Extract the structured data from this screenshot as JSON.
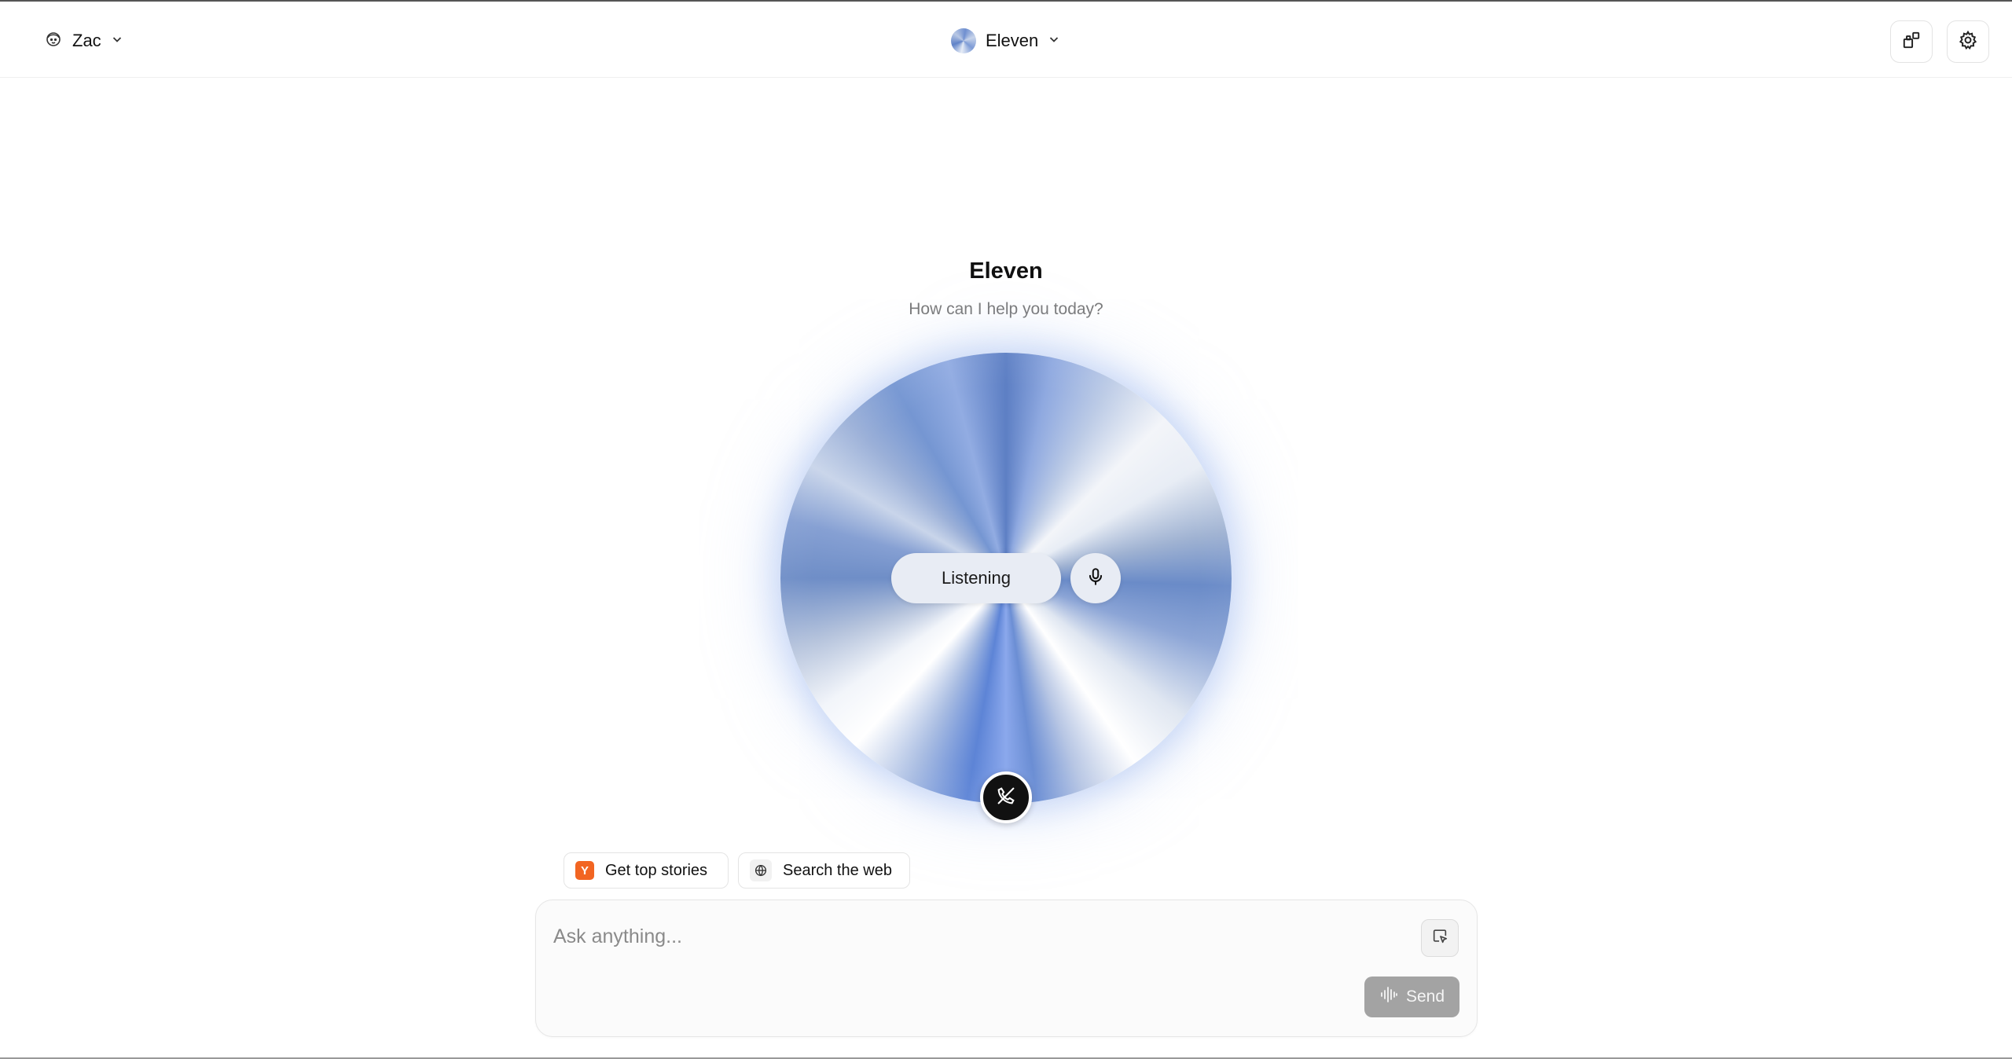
{
  "header": {
    "user": {
      "name": "Zac",
      "icon": "user-face-icon"
    },
    "agent": {
      "name": "Eleven",
      "icon": "agent-orb-icon"
    },
    "buttons": {
      "widgets_icon": "widgets-icon",
      "settings_icon": "gear-icon"
    }
  },
  "hero": {
    "title": "Eleven",
    "subtitle": "How can I help you today?",
    "status_label": "Listening",
    "mic_icon": "microphone-icon",
    "end_call_icon": "phone-off-icon"
  },
  "suggestions": [
    {
      "label": "Get top stories",
      "icon": "y-combinator-icon",
      "icon_text": "Y",
      "icon_color": "#f26522"
    },
    {
      "label": "Search the web",
      "icon": "web-search-icon"
    }
  ],
  "composer": {
    "placeholder": "Ask anything...",
    "attach_icon": "screen-select-icon",
    "send_label": "Send",
    "send_icon": "waveform-icon"
  }
}
